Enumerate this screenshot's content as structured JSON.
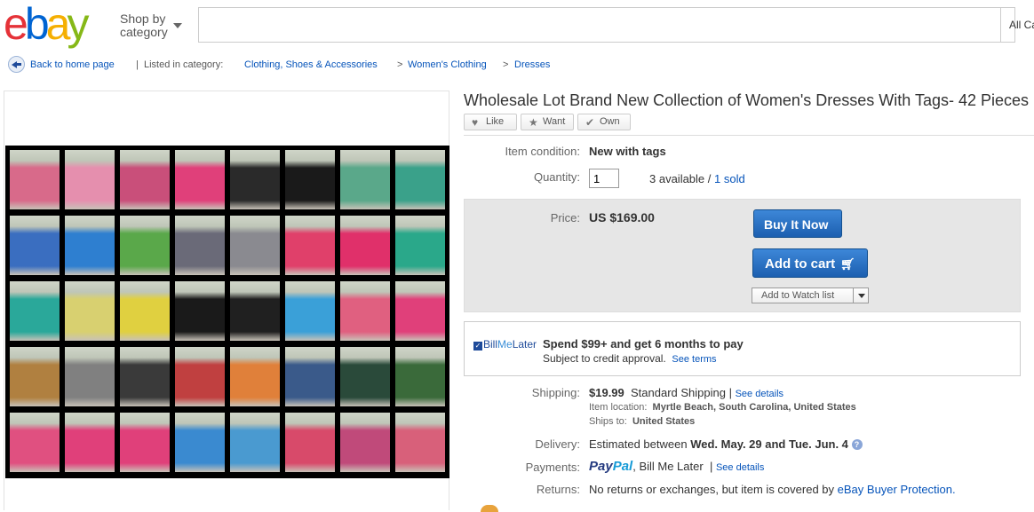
{
  "header": {
    "logo": [
      "e",
      "b",
      "a",
      "y"
    ],
    "shop_by_line1": "Shop by",
    "shop_by_line2": "category",
    "search_value": "",
    "category_select": "All Ca"
  },
  "breadcrumb": {
    "back": "Back to home page",
    "divider": "|",
    "listed_in": "Listed in category:",
    "items": [
      "Clothing, Shoes & Accessories",
      "Women's Clothing",
      "Dresses"
    ],
    "sep": ">"
  },
  "item": {
    "title": "Wholesale Lot Brand New Collection of Women's Dresses With Tags- 42 Pieces",
    "social": [
      "Like",
      "Want",
      "Own"
    ]
  },
  "details": {
    "condition_label": "Item condition:",
    "condition_value": "New with tags",
    "quantity_label": "Quantity:",
    "quantity_value": "1",
    "available": "3 available /",
    "sold": "1 sold",
    "price_label": "Price:",
    "price_value": "US $169.00",
    "buy_now": "Buy It Now",
    "add_to_cart": "Add to cart",
    "watch": "Add to Watch list"
  },
  "billmelater": {
    "logo_check": "✓",
    "logo_bill": "Bill",
    "logo_me": "Me",
    "logo_later": "Later",
    "main": "Spend $99+ and get 6 months to pay",
    "sub": "Subject to credit approval.",
    "terms": "See terms"
  },
  "shipping": {
    "label": "Shipping:",
    "cost": "$19.99",
    "method": "Standard Shipping |",
    "details_link": "See details",
    "location_label": "Item location:",
    "location": "Myrtle Beach, South Carolina, United States",
    "ships_to_label": "Ships to:",
    "ships_to": "United States"
  },
  "delivery": {
    "label": "Delivery:",
    "text": "Estimated between",
    "dates": "Wed. May. 29 and Tue. Jun. 4",
    "help": "?"
  },
  "payments": {
    "label": "Payments:",
    "paypal_1": "Pay",
    "paypal_2": "Pal",
    "methods": ", Bill Me Later",
    "divider": "|",
    "details_link": "See details"
  },
  "returns": {
    "label": "Returns:",
    "text": "No returns or exchanges, but item is covered by",
    "link": "eBay Buyer Protection."
  },
  "thumb_colors": [
    "#d86a8a",
    "#e58fae",
    "#c94f7a",
    "#e0407a",
    "#2a2a2a",
    "#1a1a1a",
    "#5aa88a",
    "#3aa18a",
    "#3a6ec0",
    "#2e7fd0",
    "#5aa84a",
    "#6a6a78",
    "#8a8a90",
    "#e0406a",
    "#e0306a",
    "#2aa88a",
    "#2aa89a",
    "#d8d070",
    "#e0d040",
    "#1a1a1a",
    "#202020",
    "#3aa0d8",
    "#e06080",
    "#e0407a",
    "#b08040",
    "#808080",
    "#3a3a3a",
    "#c04040",
    "#e0803a",
    "#3a5a8a",
    "#2a4a3a",
    "#3a6a3a",
    "#e05080",
    "#e0407a",
    "#e0407a",
    "#3a8ad0",
    "#4a9ad0",
    "#d84a6a",
    "#c04a7a",
    "#d8607a"
  ]
}
